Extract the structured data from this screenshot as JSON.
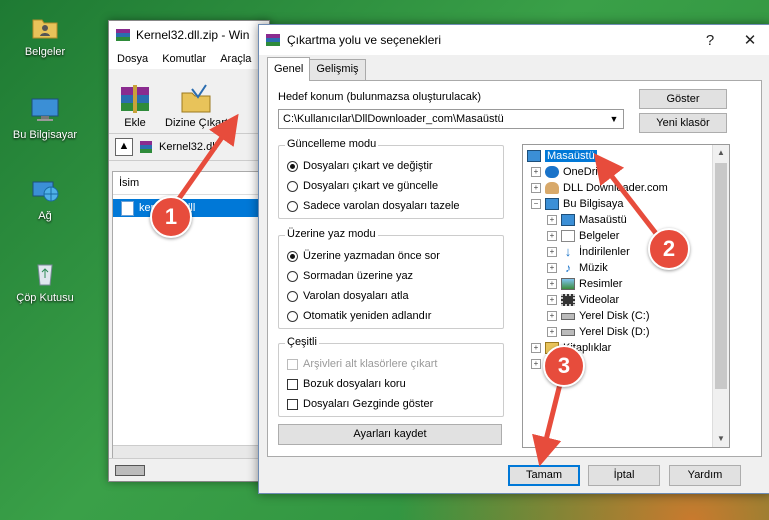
{
  "desktop": {
    "icons": [
      {
        "label": "Belgeler",
        "icon": "folder-user-icon"
      },
      {
        "label": "Bu Bilgisayar",
        "icon": "computer-icon"
      },
      {
        "label": "Ağ",
        "icon": "network-globe-icon"
      },
      {
        "label": "Çöp Kutusu",
        "icon": "recycle-bin-icon"
      }
    ]
  },
  "winrar": {
    "title": "Kernel32.dll.zip - Win",
    "menu": [
      "Dosya",
      "Komutlar",
      "Araçla"
    ],
    "tools": [
      "Ekle",
      "Dizine Çıkart"
    ],
    "address": "Kernel32.dll",
    "column": "İsim",
    "file": "kernel32.dll"
  },
  "dialog": {
    "title": "Çıkartma yolu ve seçenekleri",
    "help": "?",
    "close": "✕",
    "tabs": [
      "Genel",
      "Gelişmiş"
    ],
    "dest_label": "Hedef konum (bulunmazsa oluşturulacak)",
    "dest_value": "C:\\Kullanıcılar\\DllDownloader_com\\Masaüstü",
    "btn_show": "Göster",
    "btn_newfolder": "Yeni klasör",
    "update": {
      "title": "Güncelleme modu",
      "options": [
        "Dosyaları çıkart ve değiştir",
        "Dosyaları çıkart ve güncelle",
        "Sadece varolan dosyaları tazele"
      ]
    },
    "overwrite": {
      "title": "Üzerine yaz modu",
      "options": [
        "Üzerine yazmadan önce sor",
        "Sormadan üzerine yaz",
        "Varolan dosyaları atla",
        "Otomatik yeniden adlandır"
      ]
    },
    "misc": {
      "title": "Çeşitli",
      "options": [
        "Arşivleri alt klasörlere çıkart",
        "Bozuk dosyaları koru",
        "Dosyaları Gezginde göster"
      ]
    },
    "btn_save": "Ayarları kaydet",
    "tree": [
      {
        "label": "Masaüstü"
      },
      {
        "label": "OneDri"
      },
      {
        "label": "DLL Downloader.com"
      },
      {
        "label": "Bu Bilgisaya"
      },
      {
        "label": "Masaüstü"
      },
      {
        "label": "Belgeler"
      },
      {
        "label": "İndirilenler"
      },
      {
        "label": "Müzik"
      },
      {
        "label": "Resimler"
      },
      {
        "label": "Videolar"
      },
      {
        "label": "Yerel Disk (C:)"
      },
      {
        "label": "Yerel Disk (D:)"
      },
      {
        "label": "Kitaplıklar"
      }
    ],
    "buttons": [
      "Tamam",
      "İptal",
      "Yardım"
    ]
  },
  "callouts": [
    "1",
    "2",
    "3"
  ],
  "colors": {
    "accent": "#0078d7",
    "callout": "#e74c3c"
  }
}
